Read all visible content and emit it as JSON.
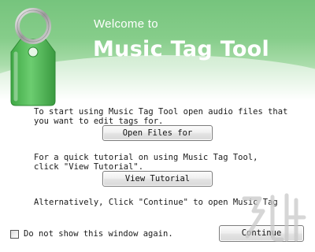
{
  "header": {
    "welcome": "Welcome to",
    "app_title": "Music Tag Tool"
  },
  "intro": {
    "line1": "To start using Music Tag Tool open audio files that",
    "line2": "you want to edit tags for."
  },
  "open_button": {
    "label": "Open Files for"
  },
  "tutorial": {
    "line1": "For a quick tutorial on using Music Tag Tool,",
    "line2": "click \"View Tutorial\"."
  },
  "tutorial_button": {
    "label": "View Tutorial"
  },
  "alternative": {
    "text": "Alternatively, Click \"Continue\" to open Music Tag"
  },
  "footer": {
    "checkbox_label": "Do not show this window again.",
    "checkbox_checked": false,
    "continue_label": "Continue"
  },
  "icons": {
    "logo": "music-tag-icon",
    "watermark": "watermark-icon"
  },
  "colors": {
    "banner_green": "#76c47d",
    "tag_green": "#4cb052"
  }
}
